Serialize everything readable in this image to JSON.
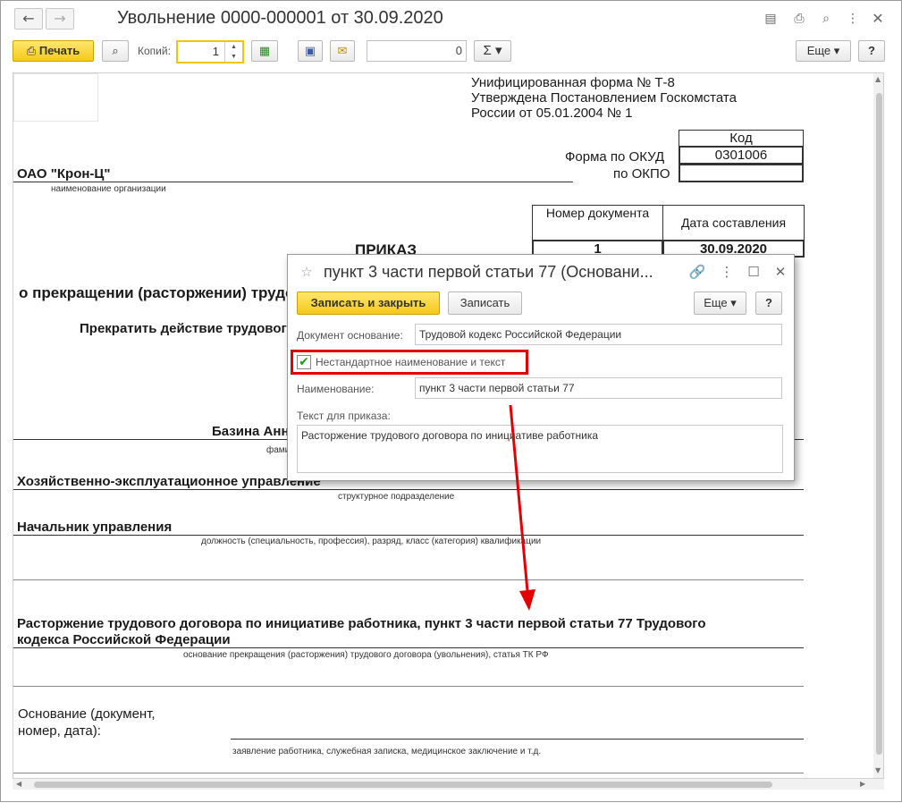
{
  "window": {
    "title": "Увольнение 0000-000001 от 30.09.2020",
    "back_icon": "←",
    "forward_icon": "→"
  },
  "toolbar": {
    "print_label": "Печать",
    "copies_label": "Копий:",
    "copies_value": "1",
    "sum_value": "0",
    "sigma_label": "Σ ▾",
    "more_label": "Еще ▾",
    "help_label": "?"
  },
  "document": {
    "form_line1": "Унифицированная форма № Т-8",
    "form_line2": "Утверждена Постановлением Госкомстата",
    "form_line3": "России от 05.01.2004 № 1",
    "kod_header": "Код",
    "okud_label": "Форма по ОКУД",
    "okud_value": "0301006",
    "okpo_label": "по ОКПО",
    "okpo_value": "",
    "org_name": "ОАО \"Крон-Ц\"",
    "org_caption": "наименование организации",
    "doc_number_header": "Номер документа",
    "doc_date_header": "Дата составления",
    "doc_number": "1",
    "doc_date": "30.09.2020",
    "order_title": "ПРИКАЗ",
    "order_subtitle": "о прекращении (расторжении) трудового договора с работником (увольнении)",
    "terminate_line": "Прекратить действие трудового договора",
    "employee_name": "Базина Анна",
    "employee_caption": "фамилия, имя, отчество",
    "division": "Хозяйственно-эксплуатационное управление",
    "division_caption": "структурное подразделение",
    "position": "Начальник управления",
    "position_caption": "должность (специальность, профессия), разряд, класс (категория) квалификации",
    "basis_line1": "Расторжение трудового договора по инициативе работника, пункт 3 части первой статьи 77 Трудового",
    "basis_line2": "кодекса Российской Федерации",
    "basis_caption": "основание прекращения (расторжения) трудового договора (увольнения), статья ТК РФ",
    "grounds_label1": "Основание (документ,",
    "grounds_label2": "номер, дата):",
    "grounds_caption": "заявление работника, служебная записка, медицинское заключение и т.д."
  },
  "dialog": {
    "title": "пункт 3 части первой статьи 77 (Основани...",
    "save_close_label": "Записать и закрыть",
    "save_label": "Записать",
    "more_label": "Еще ▾",
    "help_label": "?",
    "basis_doc_label": "Документ основание:",
    "basis_doc_value": "Трудовой кодекс Российской Федерации",
    "nonstandard_label": "Нестандартное наименование и текст",
    "nonstandard_checked": true,
    "name_label": "Наименование:",
    "name_value": "пункт 3 части первой статьи 77",
    "order_text_label": "Текст для приказа:",
    "order_text_value": "Расторжение трудового договора по инициативе работника"
  },
  "colors": {
    "accent_yellow": "#f5c91b",
    "highlight_red": "#e30000",
    "arrow_red": "#e30000"
  }
}
